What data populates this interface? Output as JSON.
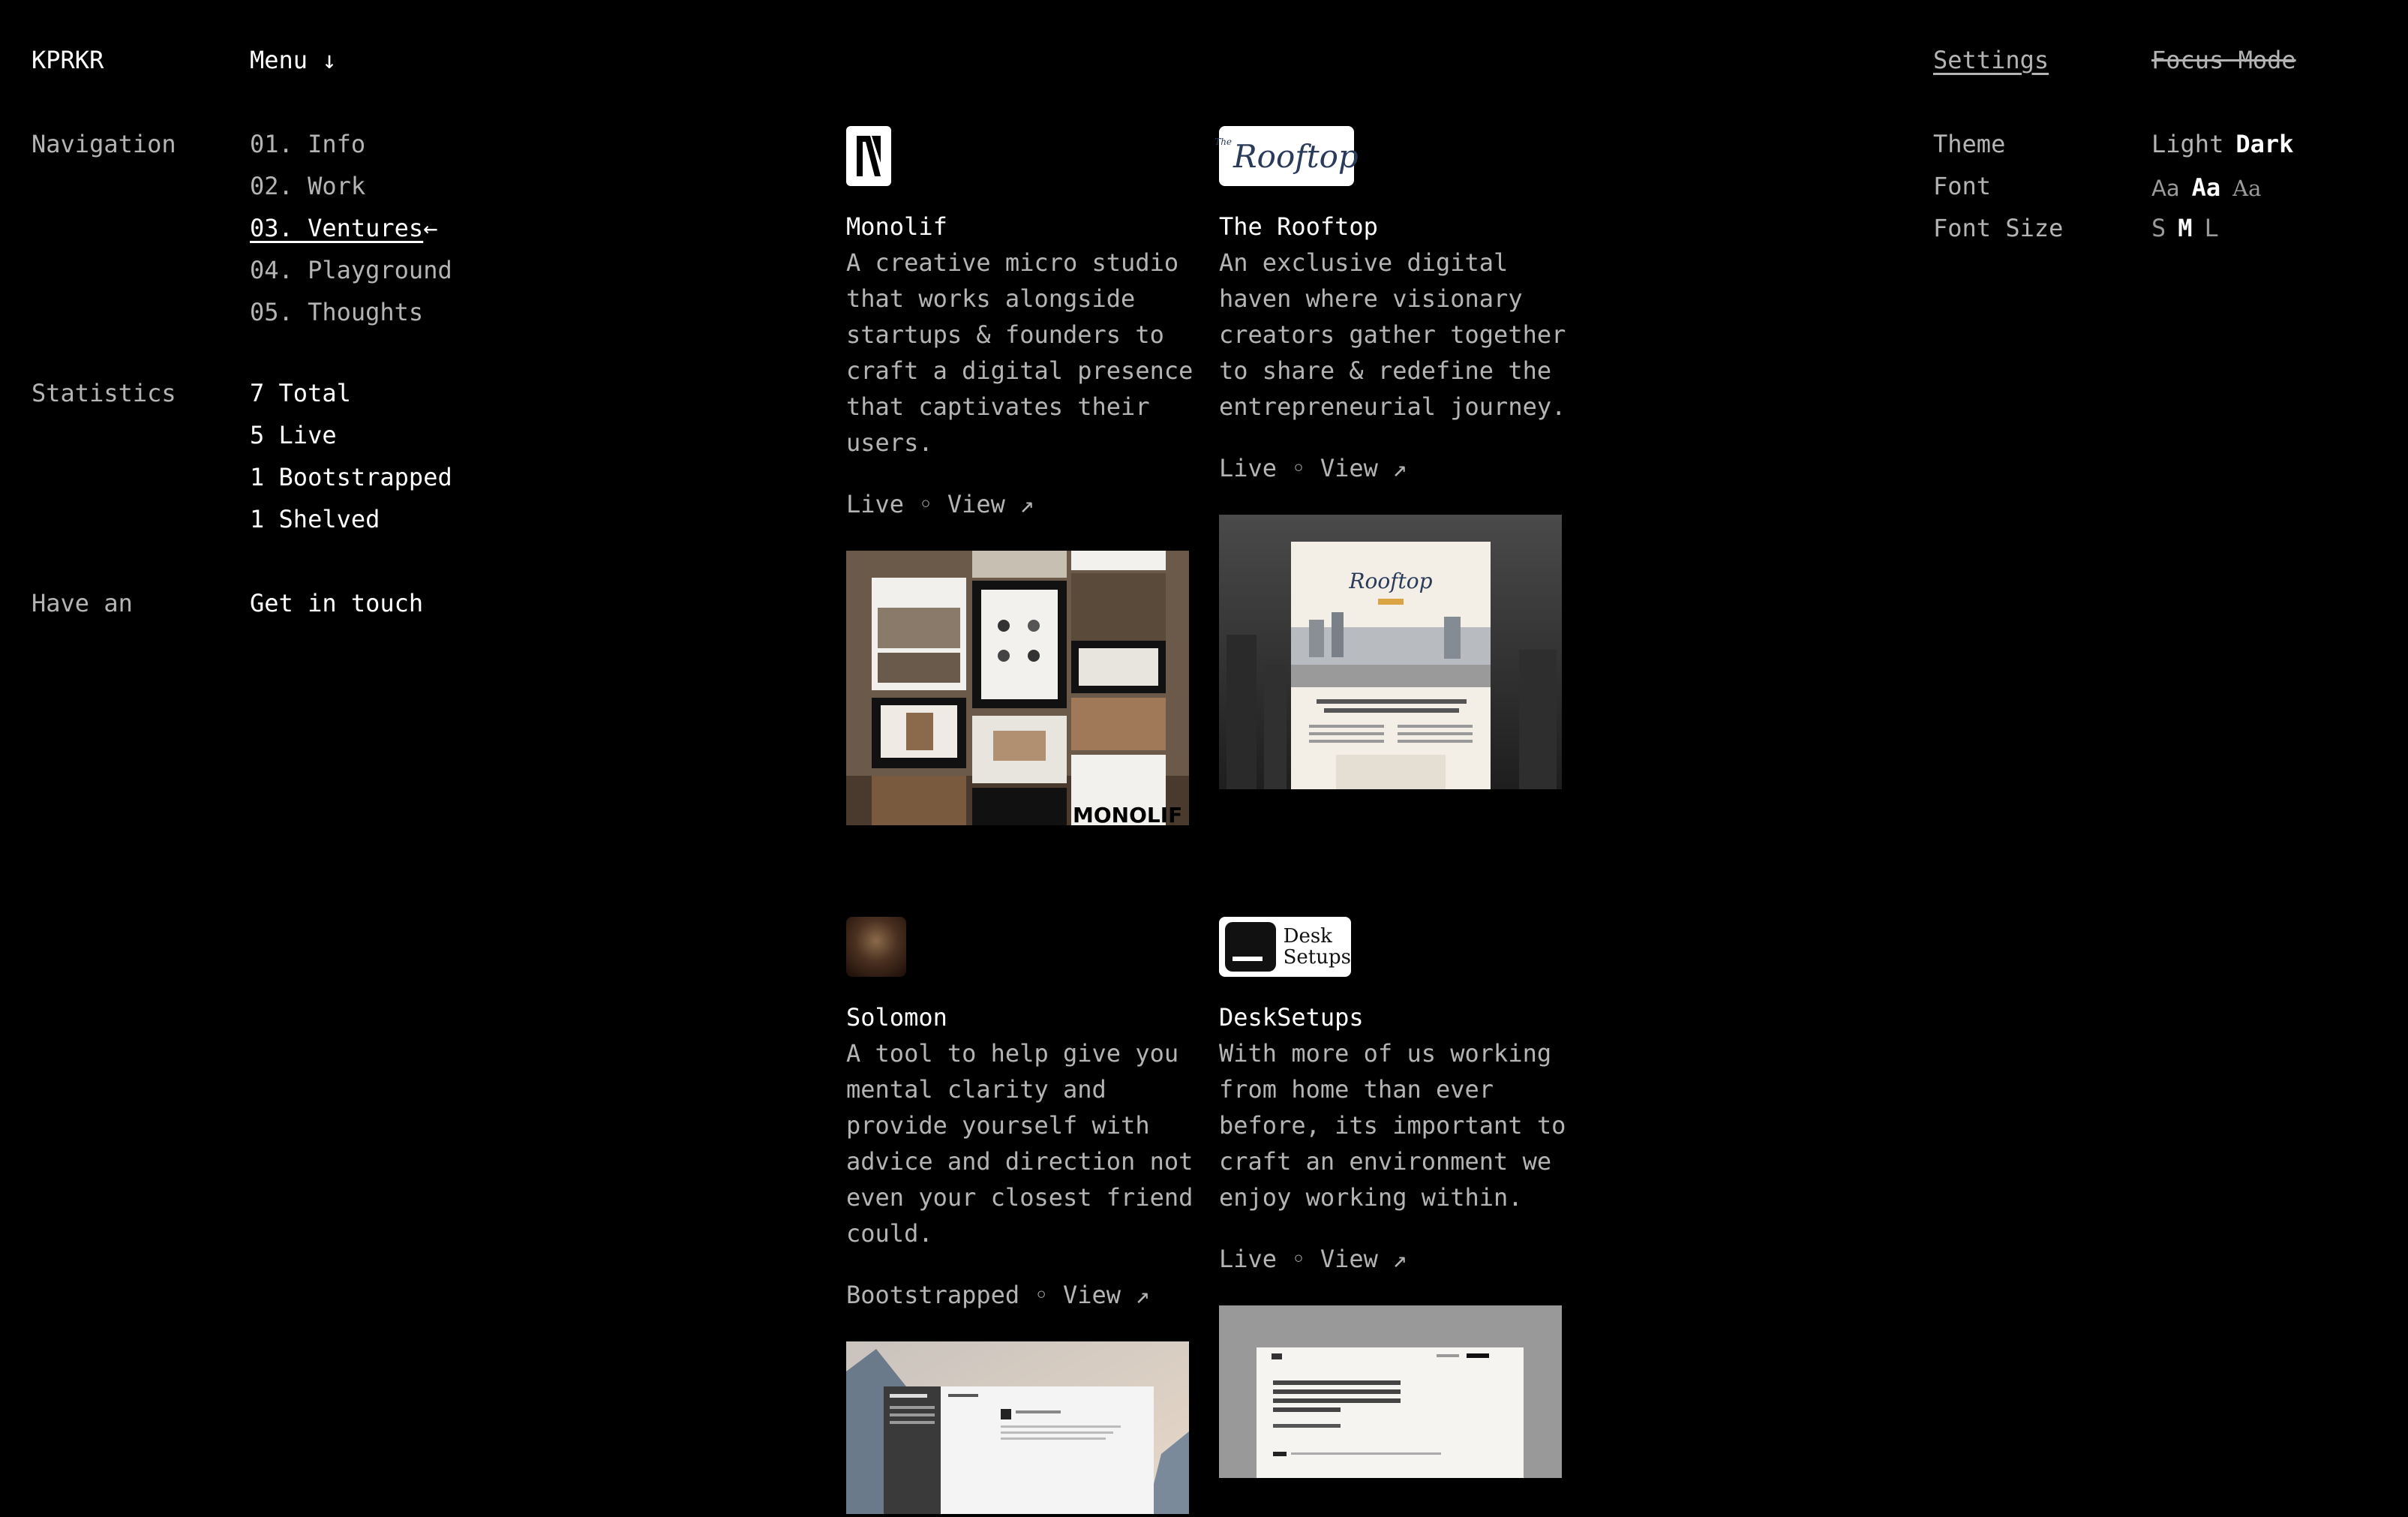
{
  "header": {
    "logo": "KPRKR",
    "menu_label": "Menu ↓",
    "settings_label": "Settings",
    "focus_mode_label": "Focus Mode"
  },
  "navigation": {
    "label": "Navigation",
    "items": [
      {
        "label": "01. Info"
      },
      {
        "label": "02. Work"
      },
      {
        "label": "03. Ventures",
        "active": true,
        "marker": "←"
      },
      {
        "label": "04. Playground"
      },
      {
        "label": "05. Thoughts"
      }
    ]
  },
  "statistics": {
    "label": "Statistics",
    "items": [
      "7 Total",
      "5 Live",
      "1 Bootstrapped",
      "1 Shelved"
    ]
  },
  "contact": {
    "label": "Have an",
    "link": "Get in touch"
  },
  "settings": {
    "theme_label": "Theme",
    "theme_options": [
      "Light",
      "Dark"
    ],
    "theme_selected": "Dark",
    "font_label": "Font",
    "font_options": [
      "Aa",
      "Aa",
      "Aa"
    ],
    "font_selected_index": 1,
    "font_size_label": "Font Size",
    "font_size_options": [
      "S",
      "M",
      "L"
    ],
    "font_size_selected": "M"
  },
  "ventures": [
    {
      "title": "Monolif",
      "description": "A creative micro studio that works alongside startups & founders to craft a digital presence that captivates their users.",
      "status": "Live",
      "separator": "◦",
      "link": "View ↗",
      "logo_icon": "monolif-logo"
    },
    {
      "title": "The Rooftop",
      "description": "An exclusive digital haven where visionary creators gather together to share & redefine the entrepreneurial journey.",
      "status": "Live",
      "separator": "◦",
      "link": "View ↗",
      "logo_text": "Rooftop",
      "logo_small": "The",
      "preview_logo": "Rooftop",
      "logo_icon": "rooftop-logo"
    },
    {
      "title": "Solomon",
      "description": "A tool to help give you mental clarity and provide yourself with advice and direction not even your closest friend could.",
      "status": "Bootstrapped",
      "separator": "◦",
      "link": "View ↗",
      "logo_icon": "solomon-avatar"
    },
    {
      "title": "DeskSetups",
      "description": "With more of us working from home than ever before, its important to craft an environment we enjoy working within.",
      "status": "Live",
      "separator": "◦",
      "link": "View ↗",
      "logo_line1": "Desk",
      "logo_line2": "Setups",
      "logo_icon": "desksetups-logo"
    }
  ]
}
